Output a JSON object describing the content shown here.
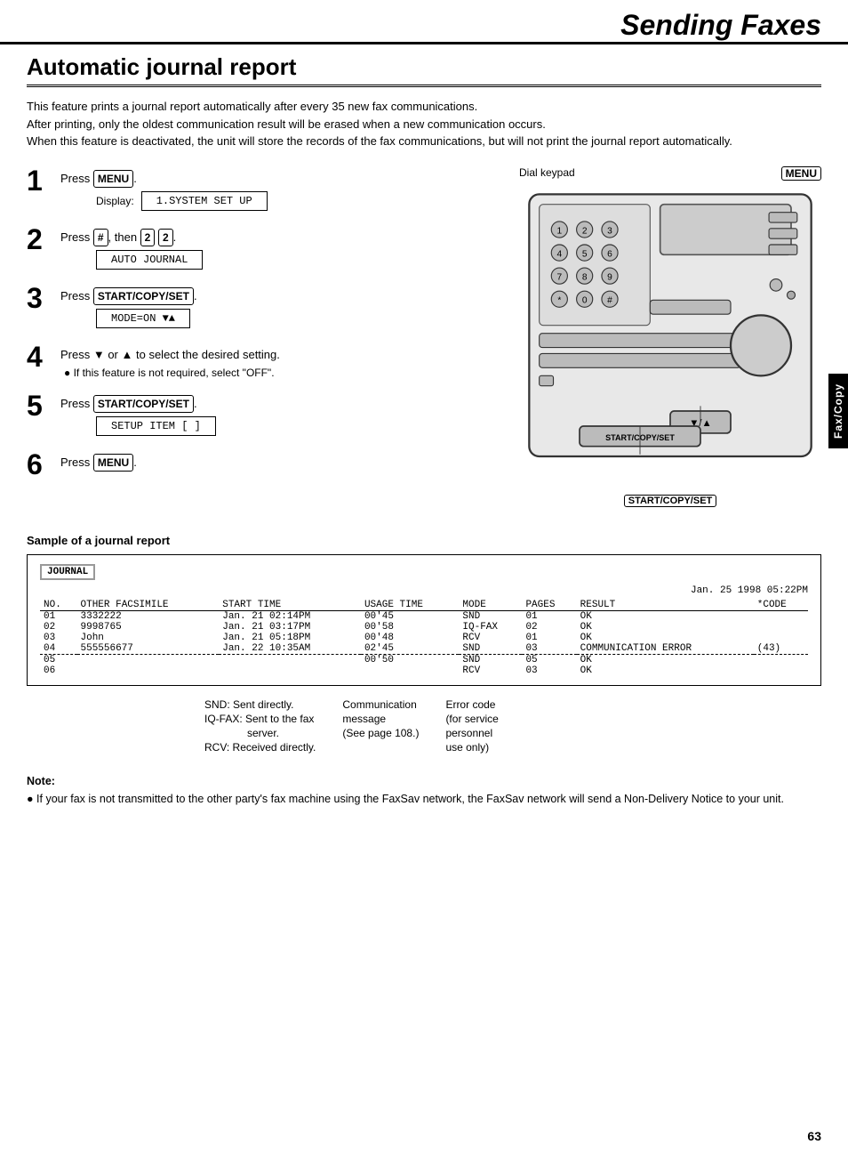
{
  "header": {
    "title": "Sending Faxes"
  },
  "section": {
    "title": "Automatic journal report"
  },
  "intro": {
    "lines": [
      "This feature prints a journal report automatically after every 35 new fax communications.",
      "After printing, only the oldest communication result will be erased when a new communication occurs.",
      "When this feature is deactivated, the unit will store the records of the fax communications, but will not print the journal report automatically."
    ]
  },
  "steps": [
    {
      "number": "1",
      "text": "Press ",
      "key": "MENU",
      "display_label": "Display:",
      "display_value": "1.SYSTEM SET UP"
    },
    {
      "number": "2",
      "text_parts": [
        "Press ",
        "#",
        ", then ",
        "2",
        "2",
        "."
      ],
      "display_value": "AUTO JOURNAL"
    },
    {
      "number": "3",
      "text": "Press ",
      "key": "START/COPY/SET",
      "display_value": "MODE=ON        ▼▲"
    },
    {
      "number": "4",
      "text": "Press ▼ or ▲ to select the desired setting.",
      "sub": "● If this feature is not required, select \"OFF\"."
    },
    {
      "number": "5",
      "text": "Press ",
      "key": "START/COPY/SET",
      "display_value": "SETUP ITEM [   ]"
    },
    {
      "number": "6",
      "text": "Press ",
      "key": "MENU"
    }
  ],
  "diagram": {
    "dial_keypad_label": "Dial keypad",
    "menu_label": "MENU",
    "start_copy_set_label": "START/COPY/SET"
  },
  "side_tab": {
    "label": "Fax/Copy"
  },
  "journal_sample": {
    "title": "Sample of a journal report",
    "label": "JOURNAL",
    "date": "Jan. 25 1998 05:22PM",
    "columns": [
      "NO.",
      "OTHER FACSIMILE",
      "START TIME",
      "USAGE TIME",
      "MODE",
      "PAGES",
      "RESULT",
      "*CODE"
    ],
    "rows": [
      [
        "01",
        "3332222",
        "Jan. 21 02:14PM",
        "00'45",
        "SND",
        "01",
        "OK",
        ""
      ],
      [
        "02",
        "9998765",
        "Jan. 21 03:17PM",
        "00'58",
        "IQ-FAX",
        "02",
        "OK",
        ""
      ],
      [
        "03",
        "John",
        "Jan. 21 05:18PM",
        "00'48",
        "RCV",
        "01",
        "OK",
        ""
      ],
      [
        "04",
        "555556677",
        "Jan. 22 10:35AM",
        "02'45",
        "SND",
        "03",
        "COMMUNICATION ERROR",
        "(43)"
      ],
      [
        "05",
        "",
        "",
        "00'50",
        "SND",
        "05",
        "OK",
        ""
      ],
      [
        "06",
        "",
        "",
        "",
        "RCV",
        "03",
        "OK",
        ""
      ]
    ]
  },
  "legend": {
    "col1": [
      "SND:    Sent directly.",
      "IQ-FAX: Sent to the fax",
      "        server.",
      "RCV:    Received directly."
    ],
    "col2": [
      "Communication",
      "message",
      "(See page 108.)"
    ],
    "col3": [
      "Error code",
      "(for service",
      "personnel",
      "use only)"
    ]
  },
  "note": {
    "title": "Note:",
    "text": "● If your fax is not transmitted to the other party's fax machine using the FaxSav network, the FaxSav network will send a Non-Delivery Notice to your unit."
  },
  "page_number": "63"
}
